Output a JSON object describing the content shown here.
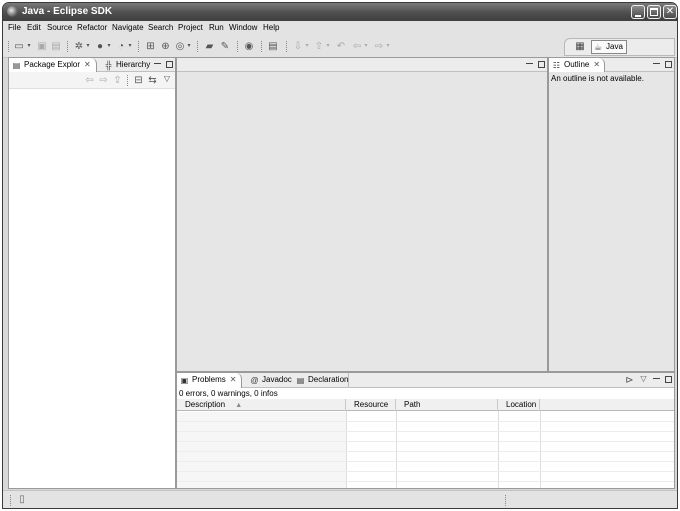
{
  "window": {
    "title": "Java - Eclipse SDK"
  },
  "menu": [
    "File",
    "Edit",
    "Source",
    "Refactor",
    "Navigate",
    "Search",
    "Project",
    "Run",
    "Window",
    "Help"
  ],
  "perspective": {
    "label": "Java"
  },
  "left_panel": {
    "tabs": [
      "Package Explor",
      "Hierarchy"
    ]
  },
  "outline": {
    "tab": "Outline",
    "message": "An outline is not available."
  },
  "bottom_panel": {
    "tabs": [
      "Problems",
      "Javadoc",
      "Declaration"
    ],
    "summary": "0 errors, 0 warnings, 0 infos",
    "columns": [
      "Description",
      "Resource",
      "Path",
      "Location"
    ]
  }
}
